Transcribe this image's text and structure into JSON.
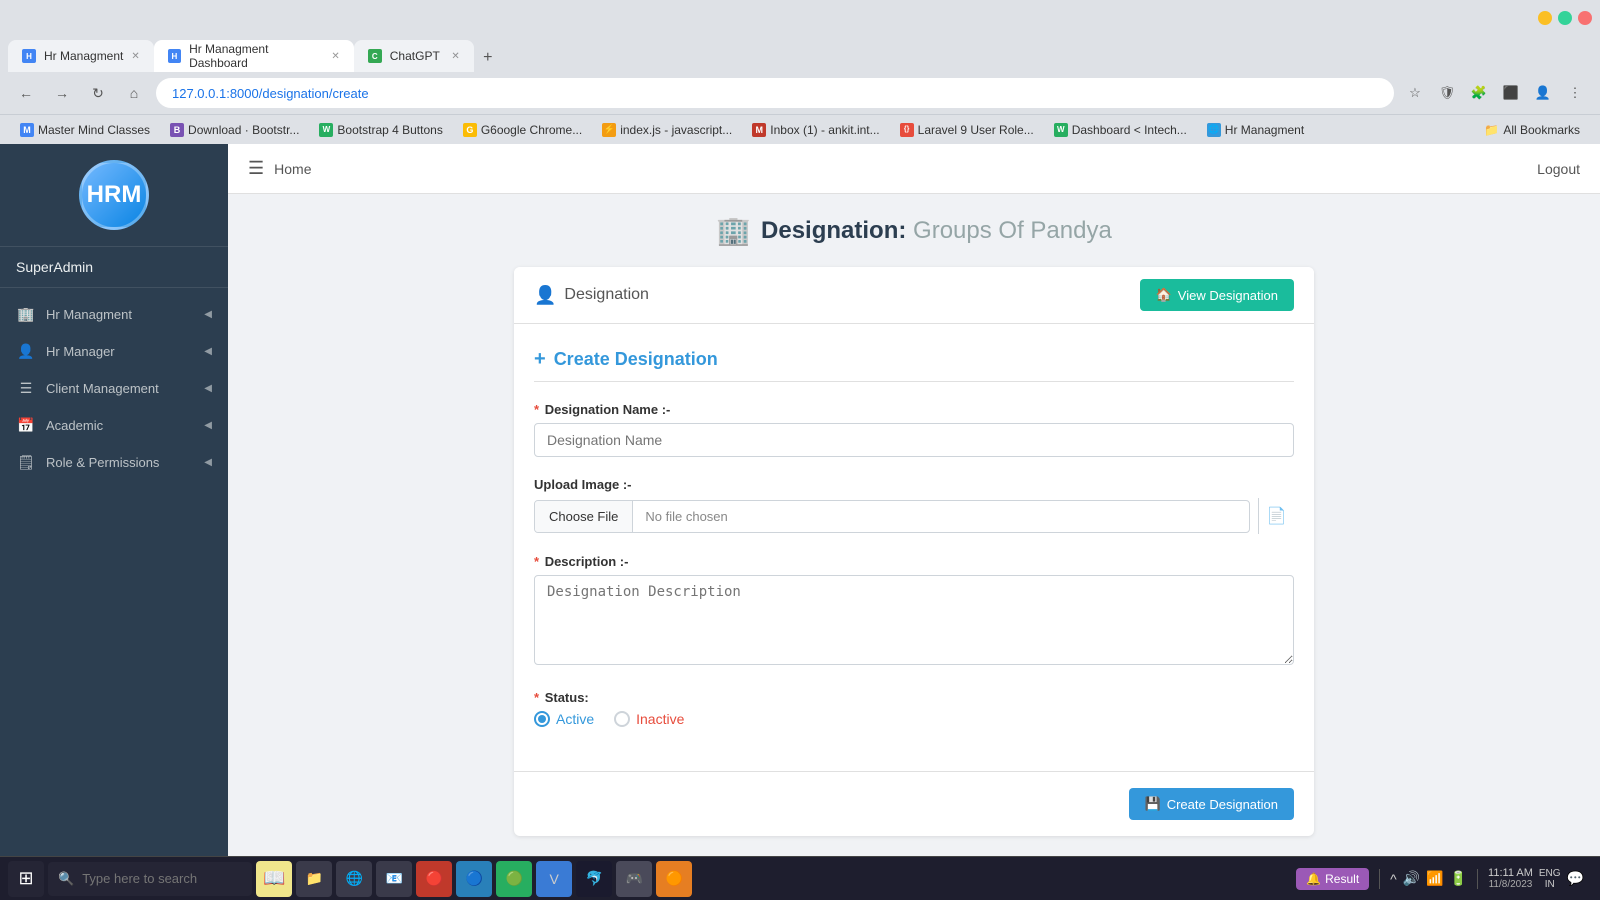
{
  "browser": {
    "tabs": [
      {
        "id": "tab1",
        "favicon_type": "blue",
        "label": "Hr Managment",
        "active": false
      },
      {
        "id": "tab2",
        "favicon_type": "blue",
        "label": "Hr Managment Dashboard",
        "active": true
      },
      {
        "id": "tab3",
        "favicon_type": "green",
        "label": "ChatGPT",
        "active": false
      }
    ],
    "address": "127.0.0.1:8000/designation/create",
    "bookmarks": [
      {
        "label": "Master Mind Classes",
        "icon": "M"
      },
      {
        "label": "Download · Bootstr...",
        "icon": "B"
      },
      {
        "label": "Bootstrap 4 Buttons",
        "icon": "W"
      },
      {
        "label": "G6oogle Chrome...",
        "icon": "G"
      },
      {
        "label": "index.js - javascript...",
        "icon": "⚡"
      },
      {
        "label": "Inbox (1) - ankit.int...",
        "icon": "M"
      },
      {
        "label": "Laravel 9 User Role...",
        "icon": "{}"
      },
      {
        "label": "Dashboard < Intech...",
        "icon": "W"
      },
      {
        "label": "Hr Managment",
        "icon": "🌐"
      }
    ],
    "all_bookmarks": "All Bookmarks"
  },
  "topnav": {
    "home": "Home",
    "logout": "Logout"
  },
  "sidebar": {
    "logo_text": "HRM",
    "user": "SuperAdmin",
    "nav_items": [
      {
        "id": "hr-management",
        "icon": "🏢",
        "label": "Hr Managment",
        "has_arrow": true
      },
      {
        "id": "hr-manager",
        "icon": "👤",
        "label": "Hr Manager",
        "has_arrow": true
      },
      {
        "id": "client-management",
        "icon": "☰",
        "label": "Client Management",
        "has_arrow": true
      },
      {
        "id": "academic",
        "icon": "📅",
        "label": "Academic",
        "has_arrow": true
      },
      {
        "id": "role-permissions",
        "icon": "🗒",
        "label": "Role & Permissions",
        "has_arrow": true
      }
    ]
  },
  "page": {
    "title_prefix": "Designation:",
    "title_org": "Groups Of Pandya",
    "title_icon": "🏢",
    "card_header": {
      "icon": "👤",
      "label": "Designation",
      "view_btn": "View Designation",
      "view_btn_icon": "🏠"
    },
    "form": {
      "section_title": "Create Designation",
      "section_icon": "+",
      "designation_name_label": "Designation Name :-",
      "designation_name_placeholder": "Designation Name",
      "upload_image_label": "Upload Image :-",
      "choose_file_btn": "Choose File",
      "no_file_text": "No file chosen",
      "description_label": "Description :-",
      "description_placeholder": "Designation Description",
      "status_label": "Status:",
      "status_active": "Active",
      "status_inactive": "Inactive",
      "submit_btn": "Create Designation",
      "submit_btn_icon": "💾"
    }
  },
  "taskbar": {
    "search_placeholder": "Type here to search",
    "result_label": "Result",
    "time": "11:11 AM",
    "date": "11/8/2023",
    "lang": "ENG",
    "region": "IN"
  }
}
